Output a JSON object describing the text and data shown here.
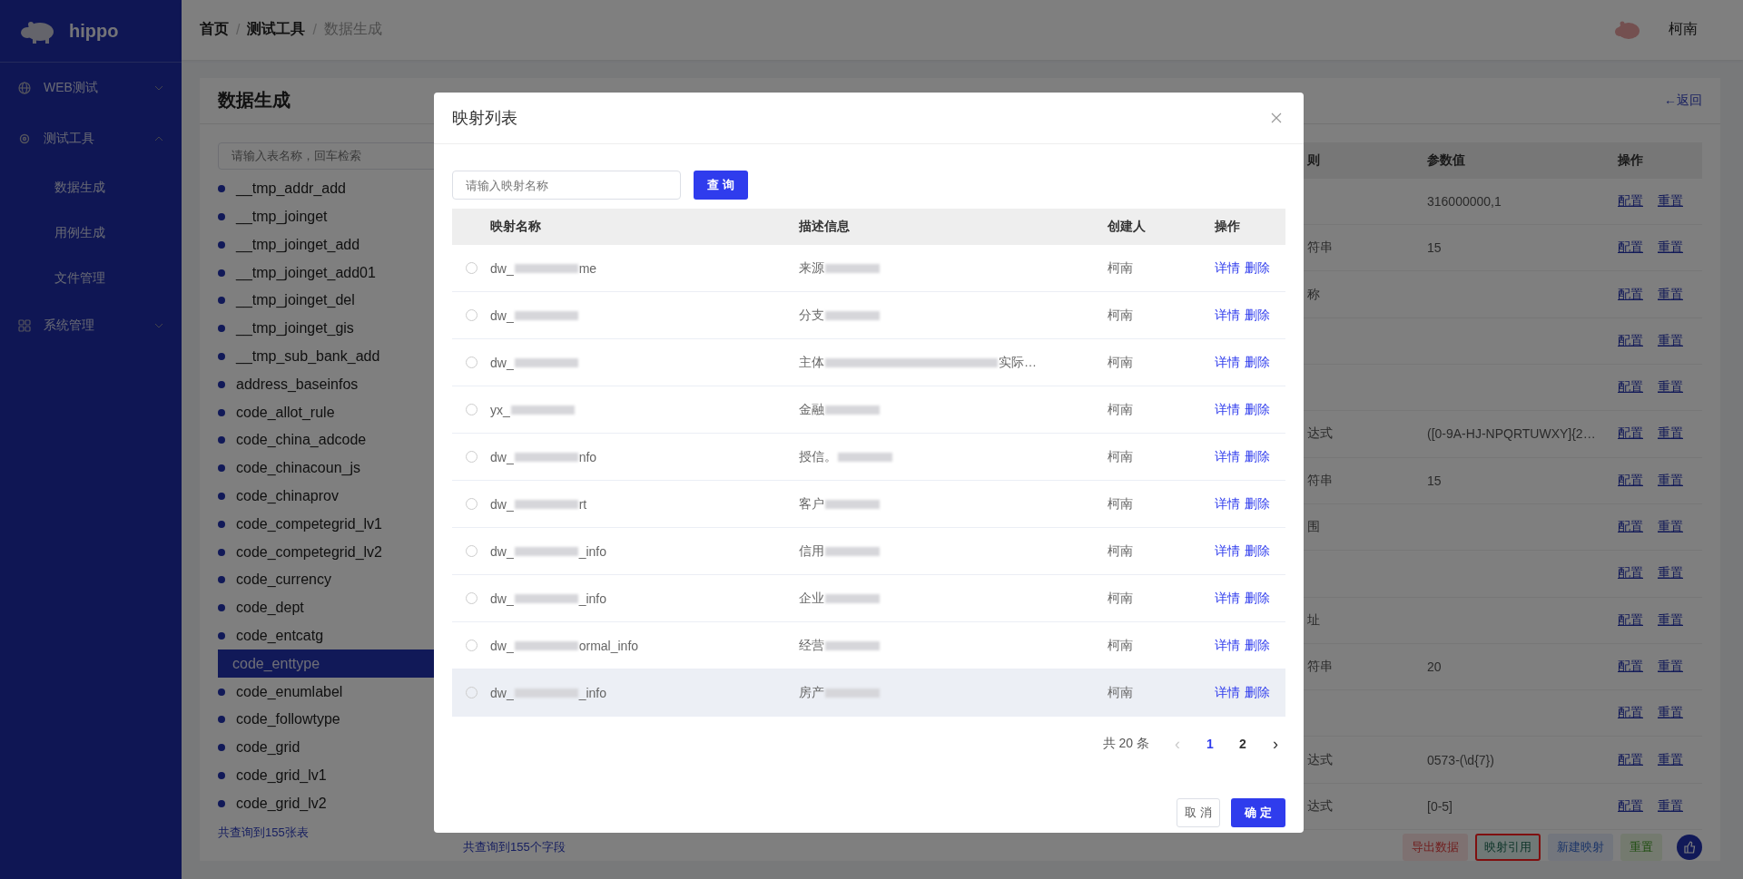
{
  "sidebar": {
    "brand": "hippo",
    "menu": [
      {
        "label": "WEB测试",
        "expanded": false
      },
      {
        "label": "测试工具",
        "expanded": true,
        "children": [
          "数据生成",
          "用例生成",
          "文件管理"
        ]
      },
      {
        "label": "系统管理",
        "expanded": false
      }
    ]
  },
  "header": {
    "breadcrumb": [
      {
        "label": "首页"
      },
      {
        "separator": "/",
        "label": "测试工具"
      },
      {
        "separator": "/",
        "label": "数据生成"
      }
    ],
    "user": "柯南"
  },
  "page": {
    "title": "数据生成",
    "back_link": "←返回",
    "table_list": {
      "placeholder": "请输入表名称，回车检索",
      "items": [
        {
          "name": "__tmp_addr_add",
          "selected": false
        },
        {
          "name": "__tmp_joinget",
          "selected": false
        },
        {
          "name": "__tmp_joinget_add",
          "selected": false
        },
        {
          "name": "__tmp_joinget_add01",
          "selected": false
        },
        {
          "name": "__tmp_joinget_del",
          "selected": false
        },
        {
          "name": "__tmp_joinget_gis",
          "selected": false
        },
        {
          "name": "__tmp_sub_bank_add",
          "selected": false
        },
        {
          "name": "address_baseinfos",
          "selected": false
        },
        {
          "name": "code_allot_rule",
          "selected": false
        },
        {
          "name": "code_china_adcode",
          "selected": false
        },
        {
          "name": "code_chinacoun_js",
          "selected": false
        },
        {
          "name": "code_chinaprov",
          "selected": false
        },
        {
          "name": "code_competegrid_lv1",
          "selected": false
        },
        {
          "name": "code_competegrid_lv2",
          "selected": false
        },
        {
          "name": "code_currency",
          "selected": false
        },
        {
          "name": "code_dept",
          "selected": false
        },
        {
          "name": "code_entcatg",
          "selected": false
        },
        {
          "name": "code_enttype",
          "selected": true
        },
        {
          "name": "code_enumlabel",
          "selected": false
        },
        {
          "name": "code_followtype",
          "selected": false
        },
        {
          "name": "code_grid",
          "selected": false
        },
        {
          "name": "code_grid_lv1",
          "selected": false
        },
        {
          "name": "code_grid_lv2",
          "selected": false
        }
      ],
      "footer": "共查询到155张表"
    },
    "fields_table": {
      "columns": [
        "则",
        "参数值",
        "操作"
      ],
      "rows": [
        {
          "rule": "",
          "value": "316000000,1",
          "actions": [
            "配置",
            "重置"
          ]
        },
        {
          "rule": "符串",
          "value": "15",
          "actions": [
            "配置",
            "重置"
          ]
        },
        {
          "rule": "称",
          "value": "",
          "actions": [
            "配置",
            "重置"
          ]
        },
        {
          "rule": "",
          "value": "",
          "actions": [
            "配置",
            "重置"
          ]
        },
        {
          "rule": "",
          "value": "",
          "actions": [
            "配置",
            "重置"
          ]
        },
        {
          "rule": "达式",
          "value": "([0-9A-HJ-NPQRTUWXY]{2…",
          "actions": [
            "配置",
            "重置"
          ]
        },
        {
          "rule": "符串",
          "value": "15",
          "actions": [
            "配置",
            "重置"
          ]
        },
        {
          "rule": "围",
          "value": "",
          "actions": [
            "配置",
            "重置"
          ]
        },
        {
          "rule": "",
          "value": "",
          "actions": [
            "配置",
            "重置"
          ]
        },
        {
          "rule": "址",
          "value": "",
          "actions": [
            "配置",
            "重置"
          ]
        },
        {
          "rule": "符串",
          "value": "20",
          "actions": [
            "配置",
            "重置"
          ]
        },
        {
          "rule": "",
          "value": "",
          "actions": [
            "配置",
            "重置"
          ]
        },
        {
          "rule": "达式",
          "value": "0573-(\\d{7})",
          "actions": [
            "配置",
            "重置"
          ]
        },
        {
          "rule": "达式",
          "value": "[0-5]",
          "actions": [
            "配置",
            "重置"
          ]
        }
      ],
      "footer": "共查询到155个字段"
    },
    "actions": [
      {
        "label": "导出数据",
        "kind": "danger",
        "highlighted": false
      },
      {
        "label": "映射引用",
        "kind": "success",
        "highlighted": true
      },
      {
        "label": "新建映射",
        "kind": "primary",
        "highlighted": false
      },
      {
        "label": "重置",
        "kind": "plain",
        "highlighted": false
      }
    ]
  },
  "dialog": {
    "title": "映射列表",
    "search_placeholder": "请输入映射名称",
    "search_button": "查 询",
    "columns": [
      "映射名称",
      "描述信息",
      "创建人",
      "操作"
    ],
    "rows": [
      {
        "name_start": "dw_",
        "name_end": "me",
        "desc_start": "来源",
        "desc_end": "",
        "creator": "柯南",
        "actions": [
          "详情",
          "删除"
        ],
        "selected": false,
        "hovered": false
      },
      {
        "name_start": "dw_",
        "name_end": "",
        "desc_start": "分支",
        "desc_end": "",
        "creator": "柯南",
        "actions": [
          "详情",
          "删除"
        ],
        "selected": false,
        "hovered": false
      },
      {
        "name_start": "dw_",
        "name_end": "",
        "desc_start": "主体",
        "desc_end": "实际…",
        "creator": "柯南",
        "actions": [
          "详情",
          "删除"
        ],
        "selected": false,
        "hovered": false
      },
      {
        "name_start": "yx_",
        "name_end": "",
        "desc_start": "金融",
        "desc_end": "",
        "creator": "柯南",
        "actions": [
          "详情",
          "删除"
        ],
        "selected": false,
        "hovered": false
      },
      {
        "name_start": "dw_",
        "name_end": "nfo",
        "desc_start": "授信。",
        "desc_end": "",
        "creator": "柯南",
        "actions": [
          "详情",
          "删除"
        ],
        "selected": false,
        "hovered": false
      },
      {
        "name_start": "dw_",
        "name_end": "rt",
        "desc_start": "客户",
        "desc_end": "",
        "creator": "柯南",
        "actions": [
          "详情",
          "删除"
        ],
        "selected": false,
        "hovered": false
      },
      {
        "name_start": "dw_",
        "name_end": "_info",
        "desc_start": "信用",
        "desc_end": "",
        "creator": "柯南",
        "actions": [
          "详情",
          "删除"
        ],
        "selected": false,
        "hovered": false
      },
      {
        "name_start": "dw_",
        "name_end": "_info",
        "desc_start": "企业",
        "desc_end": "",
        "creator": "柯南",
        "actions": [
          "详情",
          "删除"
        ],
        "selected": false,
        "hovered": false
      },
      {
        "name_start": "dw_",
        "name_end": "ormal_info",
        "desc_start": "经营",
        "desc_end": "",
        "creator": "柯南",
        "actions": [
          "详情",
          "删除"
        ],
        "selected": false,
        "hovered": false
      },
      {
        "name_start": "dw_",
        "name_end": "_info",
        "desc_start": "房产",
        "desc_end": "",
        "creator": "柯南",
        "actions": [
          "详情",
          "删除"
        ],
        "selected": false,
        "hovered": true
      }
    ],
    "pagination": {
      "total": "共 20 条",
      "prev": "‹",
      "next": "›",
      "prev_disabled": true,
      "pages": [
        {
          "label": "1",
          "selected": true
        },
        {
          "label": "2",
          "selected": false
        }
      ]
    },
    "cancel": "取 消",
    "confirm": "确 定"
  }
}
